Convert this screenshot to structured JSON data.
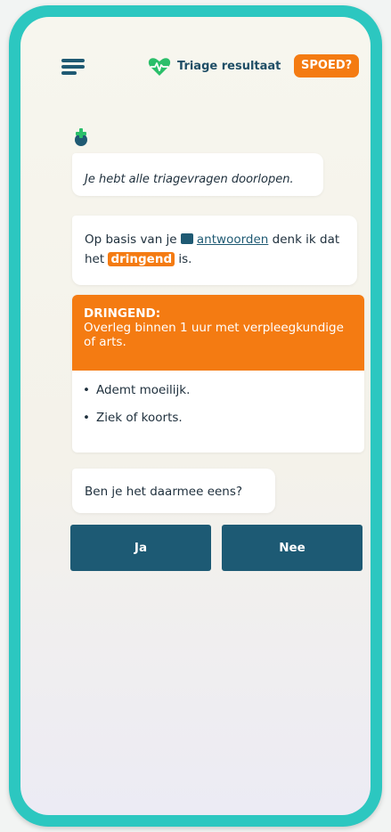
{
  "header": {
    "title": "Triage resultaat",
    "badge": "SPOED?"
  },
  "chat": {
    "message_1": "Je hebt alle triagevragen doorlopen.",
    "message_2_prefix": "Op basis van je ",
    "message_2_link": "antwoorden",
    "message_2_middle": " denk ik dat het ",
    "message_2_chip": "dringend",
    "message_2_suffix": " is."
  },
  "result": {
    "title": "DRINGEND:",
    "description": "Overleg binnen 1 uur met verpleegkundige of arts.",
    "reasons": [
      "Ademt moeilijk.",
      "Ziek of koorts."
    ]
  },
  "question": "Ben je het daarmee eens?",
  "buttons": {
    "yes": "Ja",
    "no": "Nee"
  },
  "colors": {
    "frame": "#2cc7c0",
    "accent_orange": "#f47b12",
    "primary_dark": "#1d5a74",
    "icon_green": "#2bbf6a"
  },
  "icons": [
    "menu-icon",
    "heart-pulse-icon",
    "bot-plus-icon",
    "chat-bubble-icon"
  ]
}
